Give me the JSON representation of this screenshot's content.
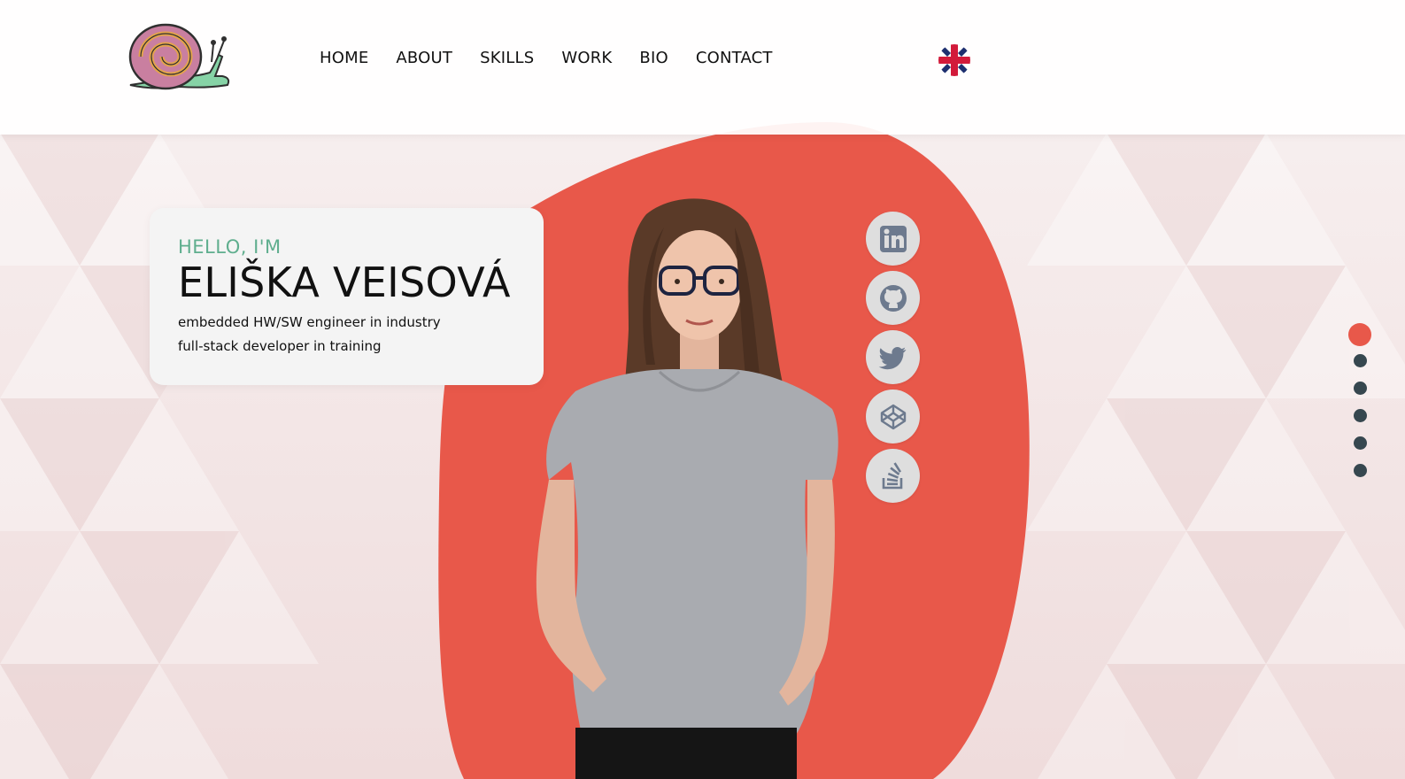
{
  "header": {
    "nav": [
      {
        "label": "HOME"
      },
      {
        "label": "ABOUT"
      },
      {
        "label": "SKILLS"
      },
      {
        "label": "WORK"
      },
      {
        "label": "BIO"
      },
      {
        "label": "CONTACT"
      }
    ],
    "language_icon": "uk-flag-icon"
  },
  "intro": {
    "greeting": "HELLO, I'M",
    "name": "ELIŠKA VEISOVÁ",
    "role_line1": "embedded HW/SW engineer in industry",
    "role_line2": "full-stack developer in training"
  },
  "socials": [
    {
      "icon": "linkedin-icon"
    },
    {
      "icon": "github-icon"
    },
    {
      "icon": "twitter-icon"
    },
    {
      "icon": "codepen-icon"
    },
    {
      "icon": "stackoverflow-icon"
    }
  ],
  "section_dots": {
    "count": 6,
    "active": 1
  },
  "colors": {
    "accent": "#e8584a",
    "greeting": "#5fae8e",
    "dot": "#36474f",
    "social_bg": "#dedede",
    "social_icon": "#6d7a8e"
  }
}
